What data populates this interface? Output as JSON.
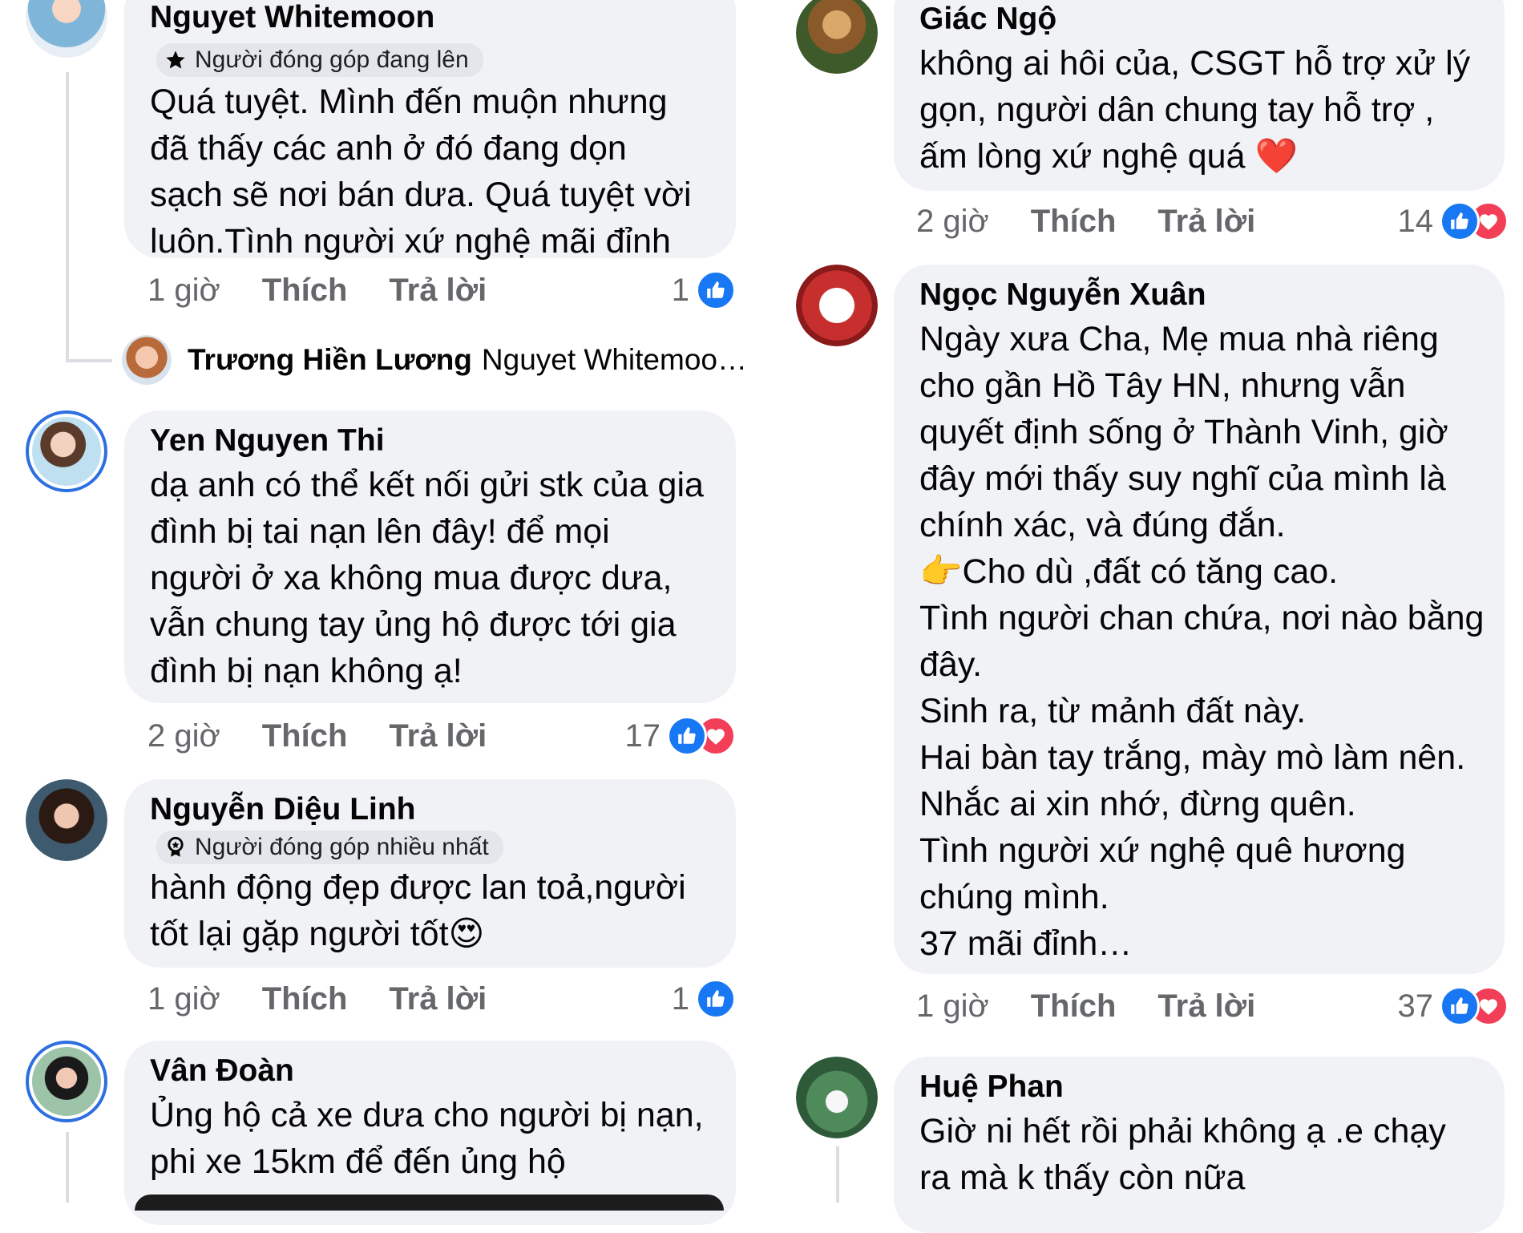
{
  "left": [
    {
      "name": "Nguyet Whitemoon",
      "badge": "Người đóng góp đang lên",
      "lines": [
        "Quá tuyệt. Mình đến muộn nhưng",
        "đã thấy các anh ở đó đang dọn",
        "sạch sẽ nơi bán dưa. Quá tuyệt vời",
        "luôn.Tình người xứ nghệ mãi đỉnh"
      ],
      "time": "1 giờ",
      "like": "Thích",
      "reply": "Trả lời",
      "count": "1",
      "reply_preview": {
        "name": "Trương Hiền Lương",
        "text": "Nguyet Whitemoo…"
      }
    },
    {
      "name": "Yen Nguyen Thi",
      "lines": [
        "dạ anh có thể kết nối gửi stk của gia",
        "đình bị tai nạn lên đây! để mọi",
        "người ở xa không mua được dưa,",
        "vẫn chung tay ủng hộ được tới gia",
        "đình bị nạn không ạ!"
      ],
      "time": "2 giờ",
      "like": "Thích",
      "reply": "Trả lời",
      "count": "17"
    },
    {
      "name": "Nguyễn Diệu Linh",
      "badge": "Người đóng góp nhiều nhất",
      "lines": [
        "hành động đẹp được lan toả,người",
        "tốt lại gặp người tốt😍"
      ],
      "time": "1 giờ",
      "like": "Thích",
      "reply": "Trả lời",
      "count": "1"
    },
    {
      "name": "Vân Đoàn",
      "lines": [
        "Ủng hộ cả xe dưa cho người bị nạn,",
        "phi xe 15km để đến ủng hộ"
      ]
    }
  ],
  "right": [
    {
      "name": "Giác Ngộ",
      "lines": [
        "không ai hôi của, CSGT hỗ trợ xử lý",
        "gọn, người dân chung tay hỗ trợ ,",
        "ấm lòng xứ nghệ quá ❤️"
      ],
      "time": "2 giờ",
      "like": "Thích",
      "reply": "Trả lời",
      "count": "14"
    },
    {
      "name": "Ngọc Nguyễn Xuân",
      "lines": [
        "Ngày xưa Cha, Mẹ mua nhà riêng",
        "cho gần Hồ Tây HN, nhưng vẫn",
        "quyết định sống ở Thành Vinh, giờ",
        "đây mới thấy suy nghĩ của mình là",
        "chính xác, và đúng đắn.",
        "👉Cho dù ,đất có tăng cao.",
        "Tình người chan chứa, nơi nào bằng",
        "đây.",
        "Sinh ra, từ mảnh đất này.",
        "Hai bàn tay trắng, mày mò làm nên.",
        "Nhắc ai xin nhớ, đừng quên.",
        "Tình người xứ nghệ quê hương",
        "chúng mình.",
        "37 mãi đỉnh…"
      ],
      "time": "1 giờ",
      "like": "Thích",
      "reply": "Trả lời",
      "count": "37"
    },
    {
      "name": "Huệ Phan",
      "lines": [
        "Giờ ni hết rồi phải không ạ .e chạy",
        "ra mà k thấy còn nữa"
      ]
    }
  ],
  "colors": {
    "like": "#1877f2",
    "love": "#f33e58",
    "bubble": "#f0f2f5",
    "story_ring": "#2d6fe0"
  }
}
